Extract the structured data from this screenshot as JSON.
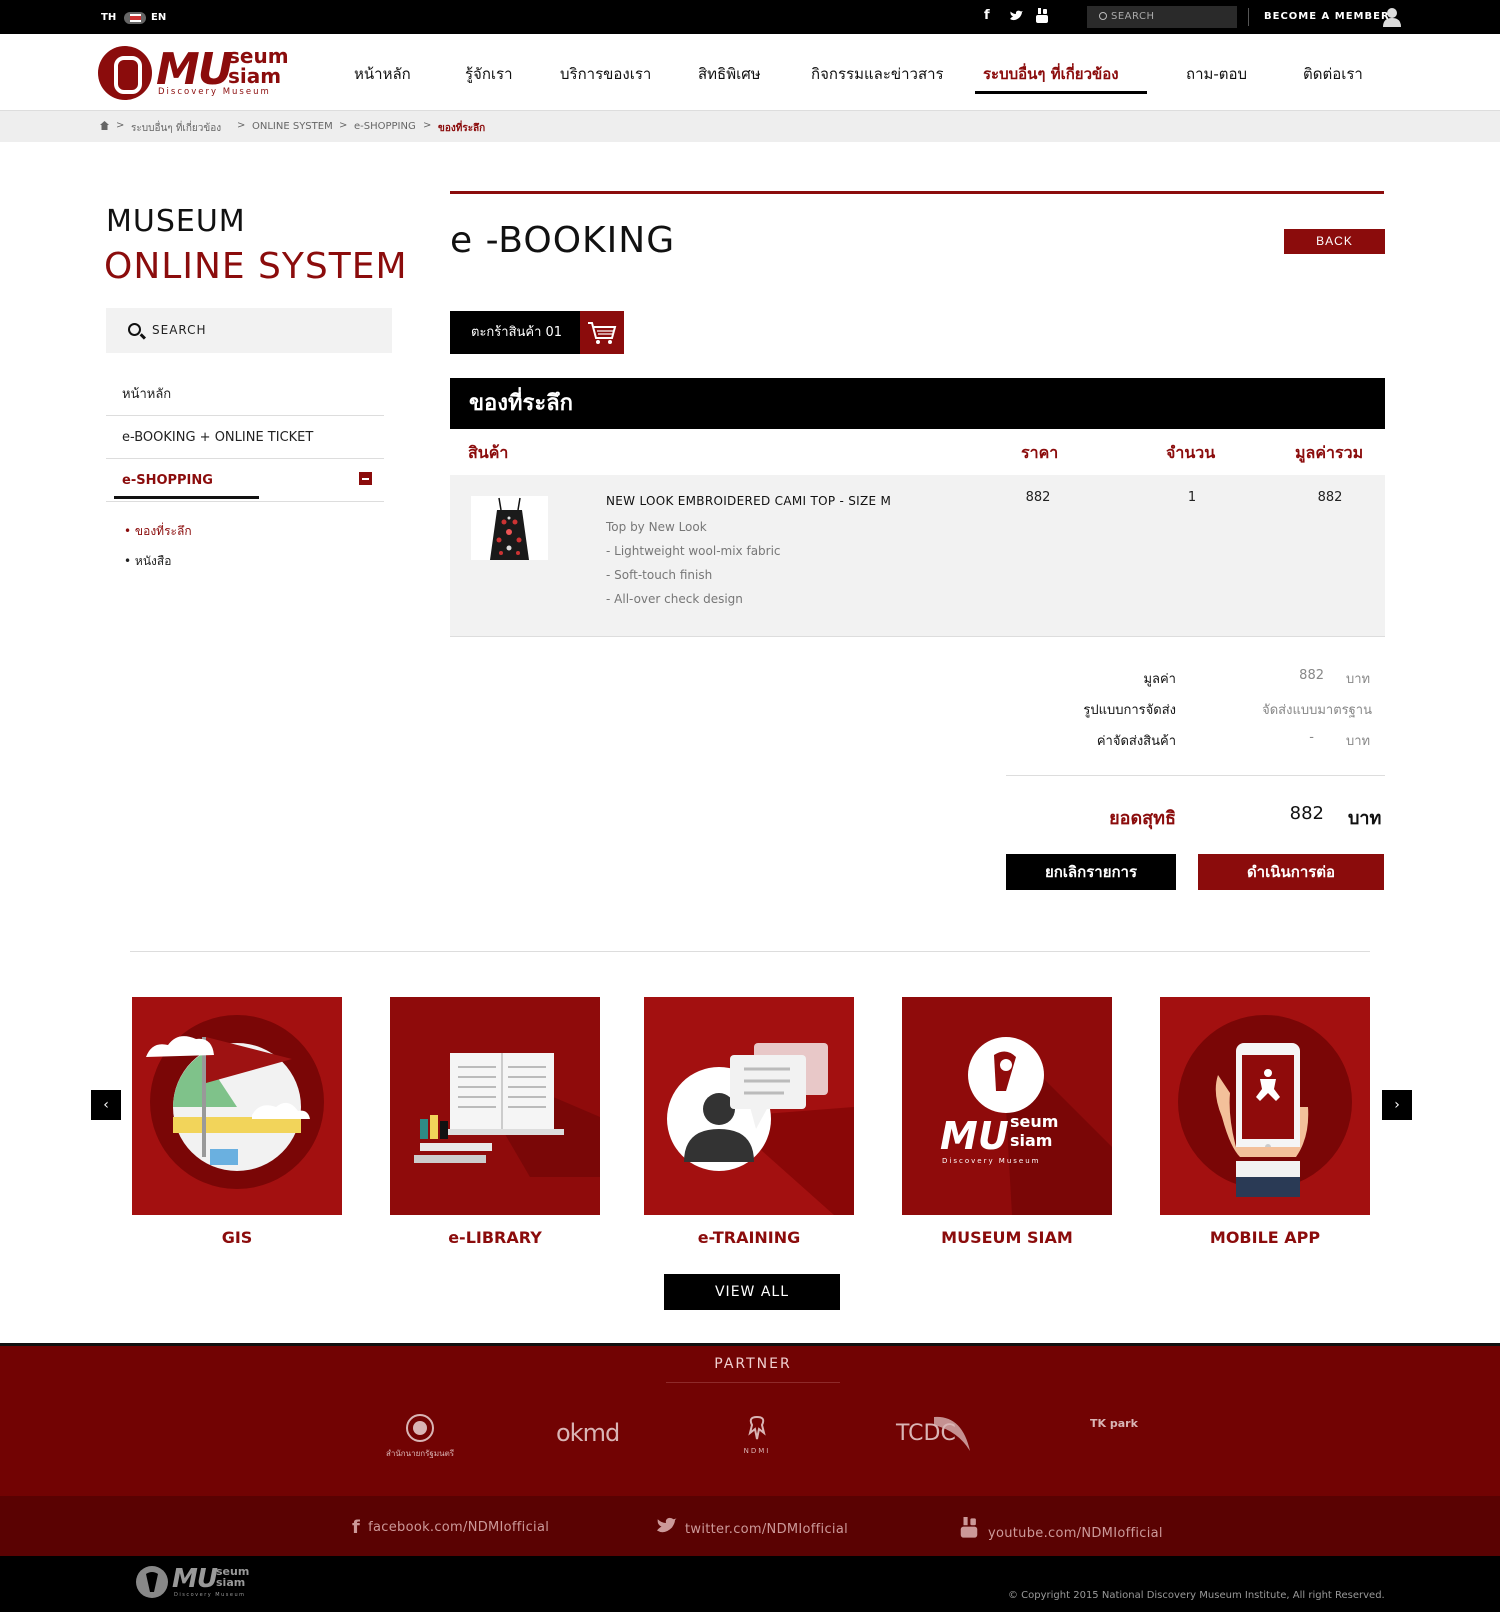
{
  "topbar": {
    "lang_th": "TH",
    "lang_en": "EN",
    "search_placeholder": "SEARCH",
    "member_label": "BECOME A MEMBER"
  },
  "brand": {
    "mu": "MU",
    "seum": "seum",
    "siam": "siam",
    "tagline": "Discovery Museum",
    "accent": "#8b0c0c"
  },
  "nav": [
    {
      "label": "หน้าหลัก"
    },
    {
      "label": "รู้จักเรา"
    },
    {
      "label": "บริการของเรา"
    },
    {
      "label": "สิทธิพิเศษ"
    },
    {
      "label": "กิจกรรมและข่าวสาร"
    },
    {
      "label": "ระบบอื่นๆ ที่เกี่ยวข้อง"
    },
    {
      "label": "ถาม-ตอบ"
    },
    {
      "label": "ติดต่อเรา"
    }
  ],
  "breadcrumb": [
    "ระบบอื่นๆ ที่เกี่ยวข้อง",
    "ONLINE SYSTEM",
    "e-SHOPPING",
    "ของที่ระลึก"
  ],
  "sidebar": {
    "title1": "MUSEUM",
    "title2": "ONLINE SYSTEM",
    "search_label": "SEARCH",
    "items": [
      "หน้าหลัก",
      "e-BOOKING + ONLINE TICKET",
      "e-SHOPPING"
    ],
    "subitems": [
      "ของที่ระลึก",
      "หนังสือ"
    ]
  },
  "main": {
    "title": "e -BOOKING",
    "back_label": "BACK",
    "cart_label": "ตะกร้าสินค้า 01",
    "section_title": "ของที่ระลึก",
    "columns": [
      "สินค้า",
      "ราคา",
      "จำนวน",
      "มูลค่ารวม"
    ],
    "product": {
      "name": "NEW LOOK EMBROIDERED CAMI TOP - SIZE M",
      "desc": [
        "Top by New Look",
        "- Lightweight wool-mix fabric",
        "- Soft-touch finish",
        "- All-over check design"
      ],
      "price": "882",
      "qty": "1",
      "total": "882"
    },
    "summary": {
      "value_label": "มูลค่า",
      "value": "882",
      "unit": "บาท",
      "shipping_label": "รูปแบบการจัดส่ง",
      "shipping_value": "จัดส่งแบบมาตรฐาน",
      "fee_label": "ค่าจัดส่งสินค้า",
      "fee_value": "-",
      "net_label": "ยอดสุทธิ",
      "net_value": "882"
    },
    "cancel_label": "ยกเลิกรายการ",
    "continue_label": "ดำเนินการต่อ"
  },
  "services": {
    "items": [
      "GIS",
      "e-LIBRARY",
      "e-TRAINING",
      "MUSEUM SIAM",
      "MOBILE APP"
    ],
    "view_all": "VIEW ALL"
  },
  "footer": {
    "partner_title": "PARTNER",
    "partners": [
      "สำนักนายกรัฐมนตรี",
      "okmd",
      "NDMI",
      "TCDC",
      "TK park"
    ],
    "facebook": "facebook.com/NDMIofficial",
    "twitter": "twitter.com/NDMIofficial",
    "youtube": "youtube.com/NDMIofficial",
    "copyright": "© Copyright 2015 National Discovery Museum Institute, All right Reserved."
  }
}
